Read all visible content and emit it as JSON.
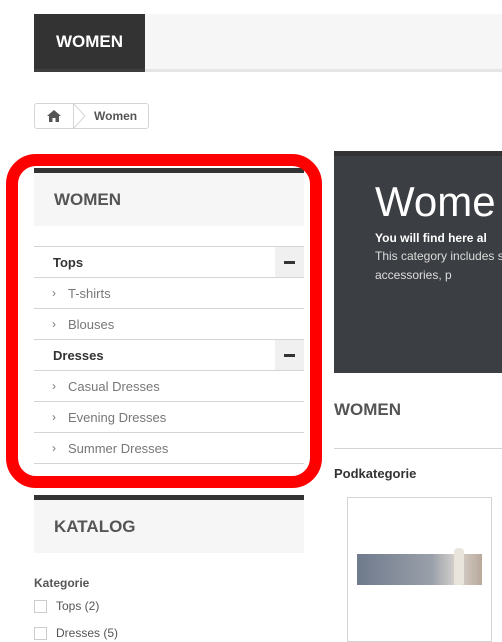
{
  "topnav": {
    "active_tab": "WOMEN"
  },
  "breadcrumb": {
    "current": "Women"
  },
  "sidebar_categories": {
    "title": "WOMEN",
    "groups": [
      {
        "label": "Tops",
        "children": [
          "T-shirts",
          "Blouses"
        ]
      },
      {
        "label": "Dresses",
        "children": [
          "Casual Dresses",
          "Evening Dresses",
          "Summer Dresses"
        ]
      }
    ]
  },
  "catalog": {
    "title": "KATALOG",
    "filter_heading": "Kategorie",
    "filters": [
      "Tops (2)",
      "Dresses (5)"
    ]
  },
  "hero": {
    "title": "Wome",
    "subtitle": "You will find here al",
    "text": "This category includes shoes, accessories, p"
  },
  "main": {
    "heading": "WOMEN",
    "subcategories_heading": "Podkategorie"
  },
  "colors": {
    "annotation": "#ff0000",
    "dark": "#333333",
    "hero_bg": "#3b3e42"
  }
}
